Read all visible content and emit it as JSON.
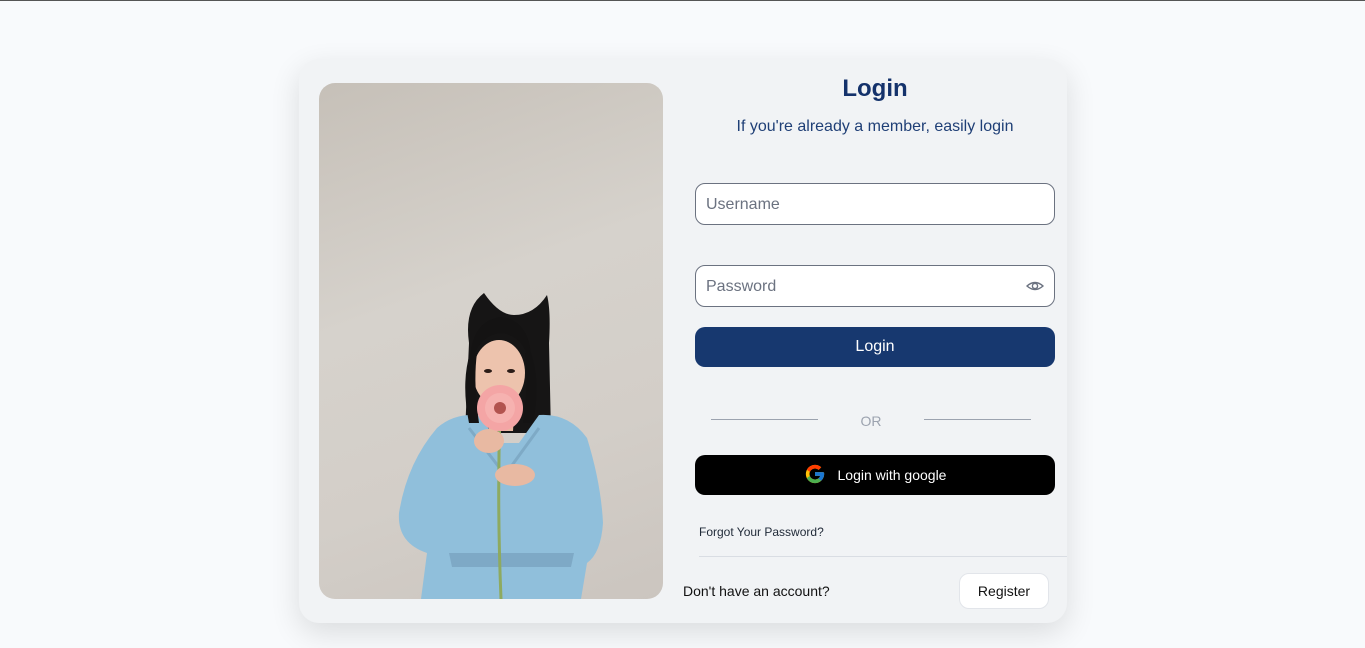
{
  "login": {
    "title": "Login",
    "subtitle": "If you're already a member, easily login",
    "username_placeholder": "Username",
    "password_placeholder": "Password",
    "login_button": "Login",
    "or_text": "OR",
    "google_button": "Login with google",
    "forgot_password": "Forgot Your Password?",
    "no_account": "Don't have an account?",
    "register_button": "Register"
  },
  "icons": {
    "password_toggle": "eye-icon",
    "google": "google-logo-icon"
  },
  "colors": {
    "primary": "#17386f",
    "title": "#14326b",
    "google_button": "#000000",
    "page_background": "#f8fafc",
    "card_background": "#f1f3f5"
  }
}
